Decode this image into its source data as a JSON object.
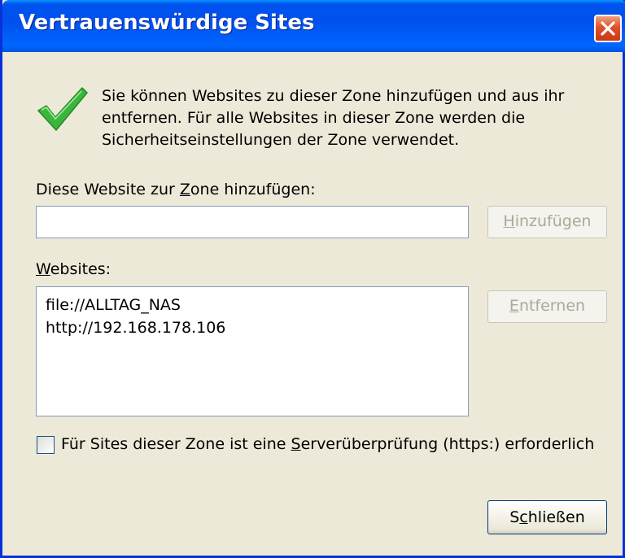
{
  "window": {
    "title": "Vertrauenswürdige Sites"
  },
  "description": {
    "line1": "Sie können Websites zu dieser Zone hinzufügen und aus ihr",
    "line2": "entfernen. Für alle Websites in dieser Zone werden die",
    "line3": "Sicherheitseinstellungen der Zone verwendet."
  },
  "add_section": {
    "label_pre": "Diese Website zur ",
    "label_key": "Z",
    "label_post": "one hinzufügen:",
    "input_value": "",
    "add_button_key": "H",
    "add_button_rest": "inzufügen"
  },
  "websites": {
    "label_key": "W",
    "label_rest": "ebsites:",
    "items": [
      "file://ALLTAG_NAS",
      "http://192.168.178.106"
    ],
    "remove_button_key": "E",
    "remove_button_rest": "ntfernen"
  },
  "https_check": {
    "label_pre": "Für Sites dieser Zone ist eine ",
    "label_key": "S",
    "label_post": "erverüberprüfung (https:) erforderlich",
    "checked": false
  },
  "close_button": {
    "pre": "S",
    "key": "c",
    "post": "hließen"
  },
  "icons": {
    "status": "checkmark-icon",
    "close": "close-icon"
  },
  "colors": {
    "titlebar": "#0054e3",
    "dialog_bg": "#ece9d8",
    "close_red": "#e0502a",
    "check_green": "#3cb53c"
  }
}
